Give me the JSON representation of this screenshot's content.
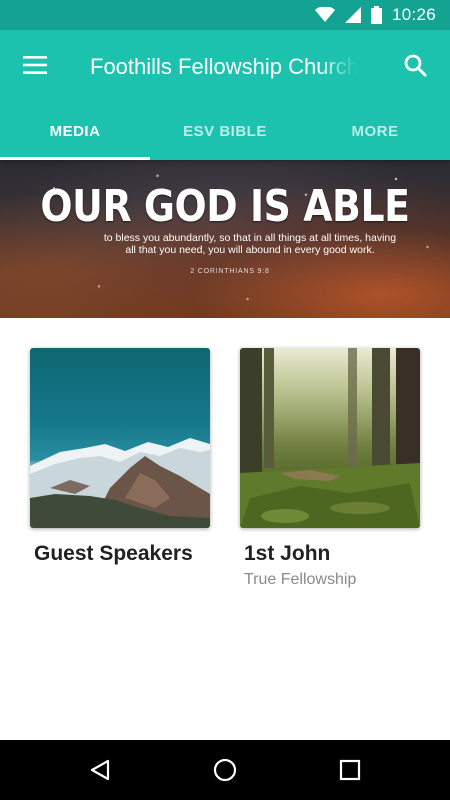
{
  "status_bar": {
    "time": "10:26",
    "icons": [
      "wifi-icon",
      "signal-icon",
      "battery-icon"
    ]
  },
  "app_bar": {
    "title": "Foothills Fellowship Church",
    "background": "#1cc2ae",
    "status_background": "#14a392",
    "icons": [
      "menu-icon",
      "search-icon"
    ]
  },
  "tabs": [
    {
      "label": "MEDIA",
      "active": true
    },
    {
      "label": "ESV BIBLE",
      "active": false
    },
    {
      "label": "MORE",
      "active": false
    }
  ],
  "banner": {
    "headline": "OUR GOD IS ABLE",
    "verse": "to bless you abundantly, so that in all things at all times, having all that you need, you will abound in every good work.",
    "reference": "2 CORINTHIANS 9:8"
  },
  "cards": [
    {
      "title": "Guest Speakers",
      "subtitle": "",
      "image": "mountain-image"
    },
    {
      "title": "1st John",
      "subtitle": "True Fellowship",
      "image": "forest-image"
    }
  ],
  "nav_bar": {
    "icons": [
      "back-icon",
      "home-icon",
      "recents-icon"
    ]
  }
}
